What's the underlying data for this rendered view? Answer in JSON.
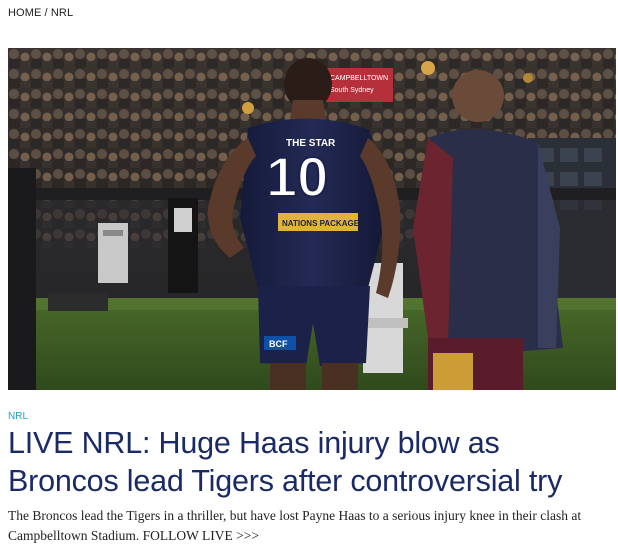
{
  "breadcrumb": {
    "home": "HOME",
    "separator": " / ",
    "section": "NRL"
  },
  "hero": {
    "image_description_icon": "hero-photo",
    "jersey_sponsor": "THE STAR",
    "jersey_number": "10",
    "jersey_sub_sponsor": "NATIONS PACKAGE",
    "shorts_sponsor": "BCF",
    "sideline_sign_line1": "CAMPBELLTOWN",
    "sideline_sign_line2": "South Sydney"
  },
  "article": {
    "section_tag": "NRL",
    "headline": "LIVE NRL: Huge Haas injury blow as Broncos lead Tigers after controversial try",
    "summary": "The Broncos lead the Tigers in a thriller, but have lost Payne Haas to a serious injury knee in their clash at Campbelltown Stadium. FOLLOW LIVE >>>"
  },
  "colors": {
    "section_tag": "#1aa3c8",
    "headline": "#1a2a66",
    "jersey_navy": "#1b2148",
    "jersey_gold": "#e0b43a"
  }
}
